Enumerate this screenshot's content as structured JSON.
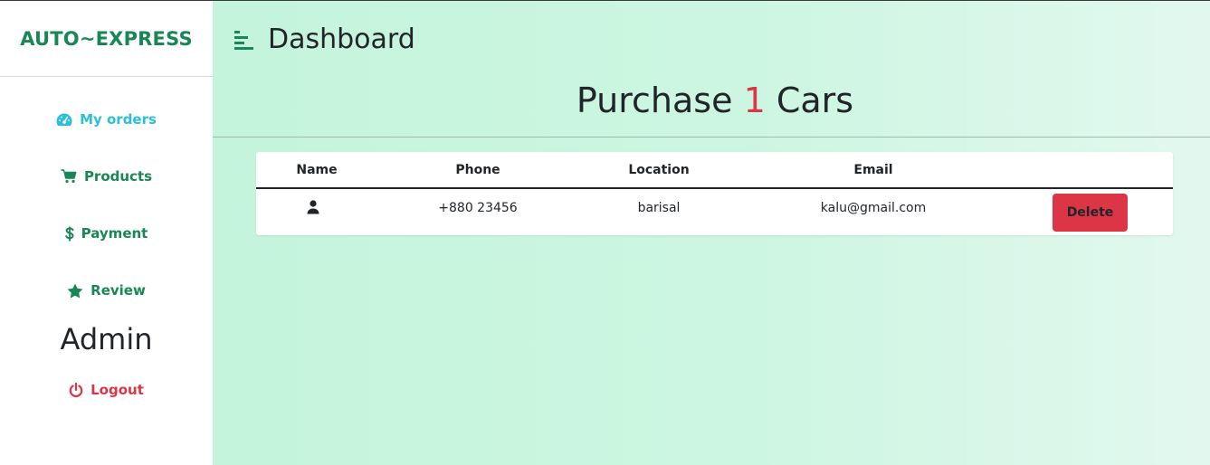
{
  "brand": {
    "name": "AUTO~EXPRESS",
    "color": "#198754"
  },
  "sidebar": {
    "items": [
      {
        "label": "My orders",
        "icon": "gauge-icon",
        "color": "#2bbfd8"
      },
      {
        "label": "Products",
        "icon": "cart-icon",
        "color": "#198754"
      },
      {
        "label": "Payment",
        "icon": "dollar-icon",
        "color": "#198754"
      },
      {
        "label": "Review",
        "icon": "star-icon",
        "color": "#198754"
      }
    ],
    "admin_title": "Admin",
    "logout": {
      "label": "Logout",
      "icon": "power-icon",
      "color": "#dc3545"
    }
  },
  "header": {
    "title": "Dashboard",
    "menu_icon": "hamburger-icon"
  },
  "summary": {
    "prefix": "Purchase",
    "count": "1",
    "suffix": "Cars",
    "count_color": "#dc3545"
  },
  "table": {
    "columns": [
      "Name",
      "Phone",
      "Location",
      "Email"
    ],
    "rows": [
      {
        "name_icon": "user-icon",
        "phone": "+880 23456",
        "location": "barisal",
        "email": "kalu@gmail.com",
        "action": "Delete"
      }
    ]
  },
  "colors": {
    "accent": "#198754",
    "danger": "#dc3545",
    "info": "#2bbfd8"
  }
}
